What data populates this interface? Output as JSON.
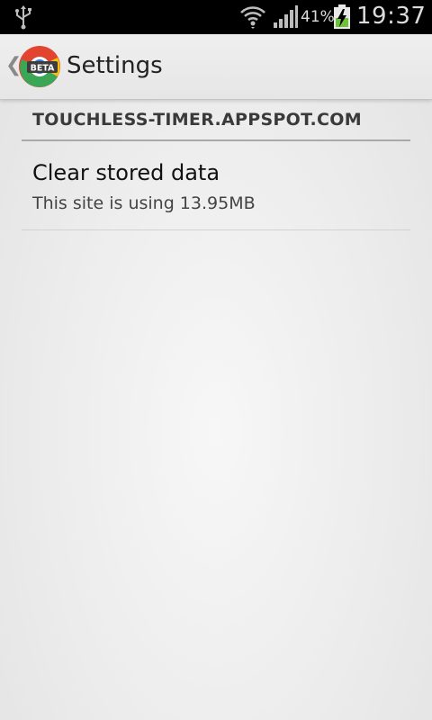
{
  "status_bar": {
    "battery_percent": "41%",
    "time": "19:37"
  },
  "action_bar": {
    "title": "Settings",
    "app_icon_badge": "BETA"
  },
  "site": {
    "header": "TOUCHLESS-TIMER.APPSPOT.COM"
  },
  "preferences": [
    {
      "title": "Clear stored data",
      "summary": "This site is using 13.95MB"
    }
  ],
  "icons": {
    "usb": "usb-icon",
    "wifi": "wifi-icon",
    "signal": "signal-icon",
    "battery": "battery-charging-icon",
    "back": "chevron-left-icon",
    "app": "chrome-beta-icon"
  },
  "colors": {
    "status_bar_bg": "#000000",
    "action_bar_bg": "#ececec",
    "battery_charge": "#6fc13a",
    "page_bg": "#ececec"
  }
}
